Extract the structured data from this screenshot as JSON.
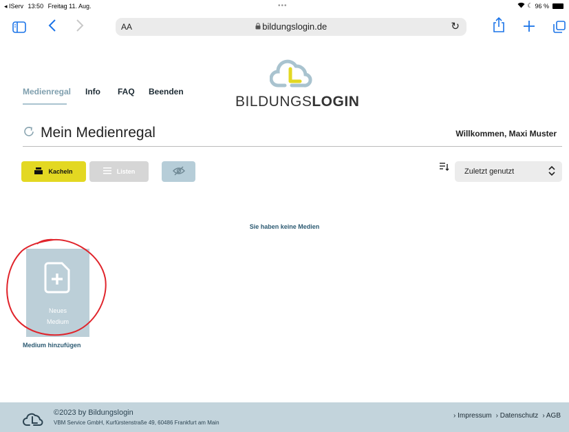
{
  "status_bar": {
    "back_app": "◂ IServ",
    "time": "13:50",
    "date": "Freitag 11. Aug.",
    "battery": "96 %"
  },
  "browser": {
    "text_size": "AA",
    "url": "bildungslogin.de",
    "lock_icon": "🔒"
  },
  "nav": {
    "items": [
      "Medienregal",
      "Info",
      "FAQ",
      "Beenden"
    ],
    "active": "Medienregal"
  },
  "logo": {
    "text_regular": "BILDUNGS",
    "text_bold": "LOGIN",
    "colors": {
      "cloud": "#a9c3cf",
      "accent": "#e3d822"
    }
  },
  "page": {
    "title": "Mein Medienregal",
    "welcome": "Willkommen, Maxi Muster"
  },
  "view_buttons": {
    "kacheln": "Kacheln",
    "listen": "Listen"
  },
  "sort": {
    "selected": "Zuletzt genutzt"
  },
  "content": {
    "empty_message": "Sie haben keine Medien",
    "tile_label_line1": "Neues",
    "tile_label_line2": "Medium",
    "add_label": "Medium hinzufügen"
  },
  "footer": {
    "copyright": "©2023 by Bildungslogin",
    "address": "VBM Service GmbH, Kurfürstenstraße 49, 60486 Frankfurt am Main",
    "links": [
      "Impressum",
      "Datenschutz",
      "AGB"
    ]
  },
  "colors": {
    "accent_yellow": "#e3d822",
    "footer_bg": "#c3d4dc",
    "tile_bg": "#bccfd8",
    "annotation_red": "#e0242b"
  }
}
